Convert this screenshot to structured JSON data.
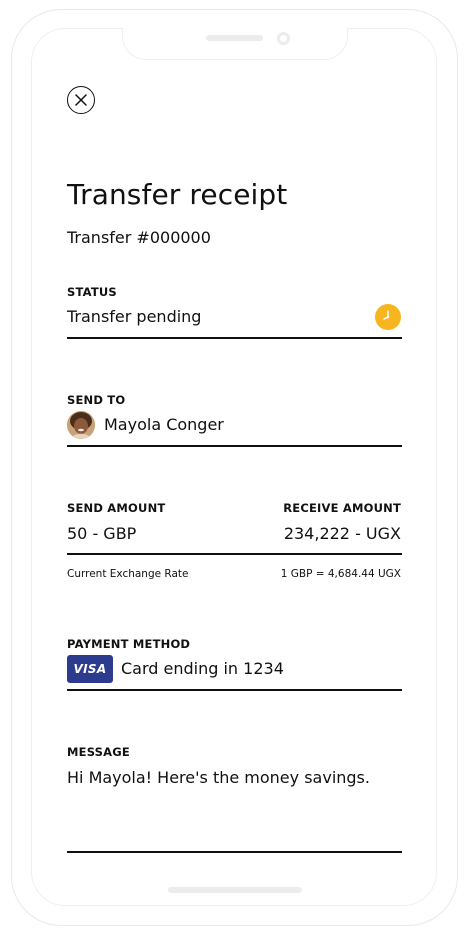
{
  "receipt": {
    "title": "Transfer receipt",
    "transfer_id": "Transfer #000000"
  },
  "status": {
    "label": "STATUS",
    "value": "Transfer pending",
    "icon": "clock-icon",
    "icon_color": "#f7b51f"
  },
  "send_to": {
    "label": "SEND TO",
    "name": "Mayola Conger"
  },
  "amounts": {
    "send_label": "SEND AMOUNT",
    "send_value": "50 - GBP",
    "receive_label": "RECEIVE AMOUNT",
    "receive_value": "234,222 - UGX",
    "rate_label": "Current Exchange Rate",
    "rate_value": "1 GBP = 4,684.44 UGX"
  },
  "payment": {
    "label": "PAYMENT METHOD",
    "card_brand": "VISA",
    "card_text": "Card ending in 1234",
    "card_color": "#2d3b8f"
  },
  "message": {
    "label": "MESSAGE",
    "text": "Hi Mayola! Here's the money savings."
  }
}
